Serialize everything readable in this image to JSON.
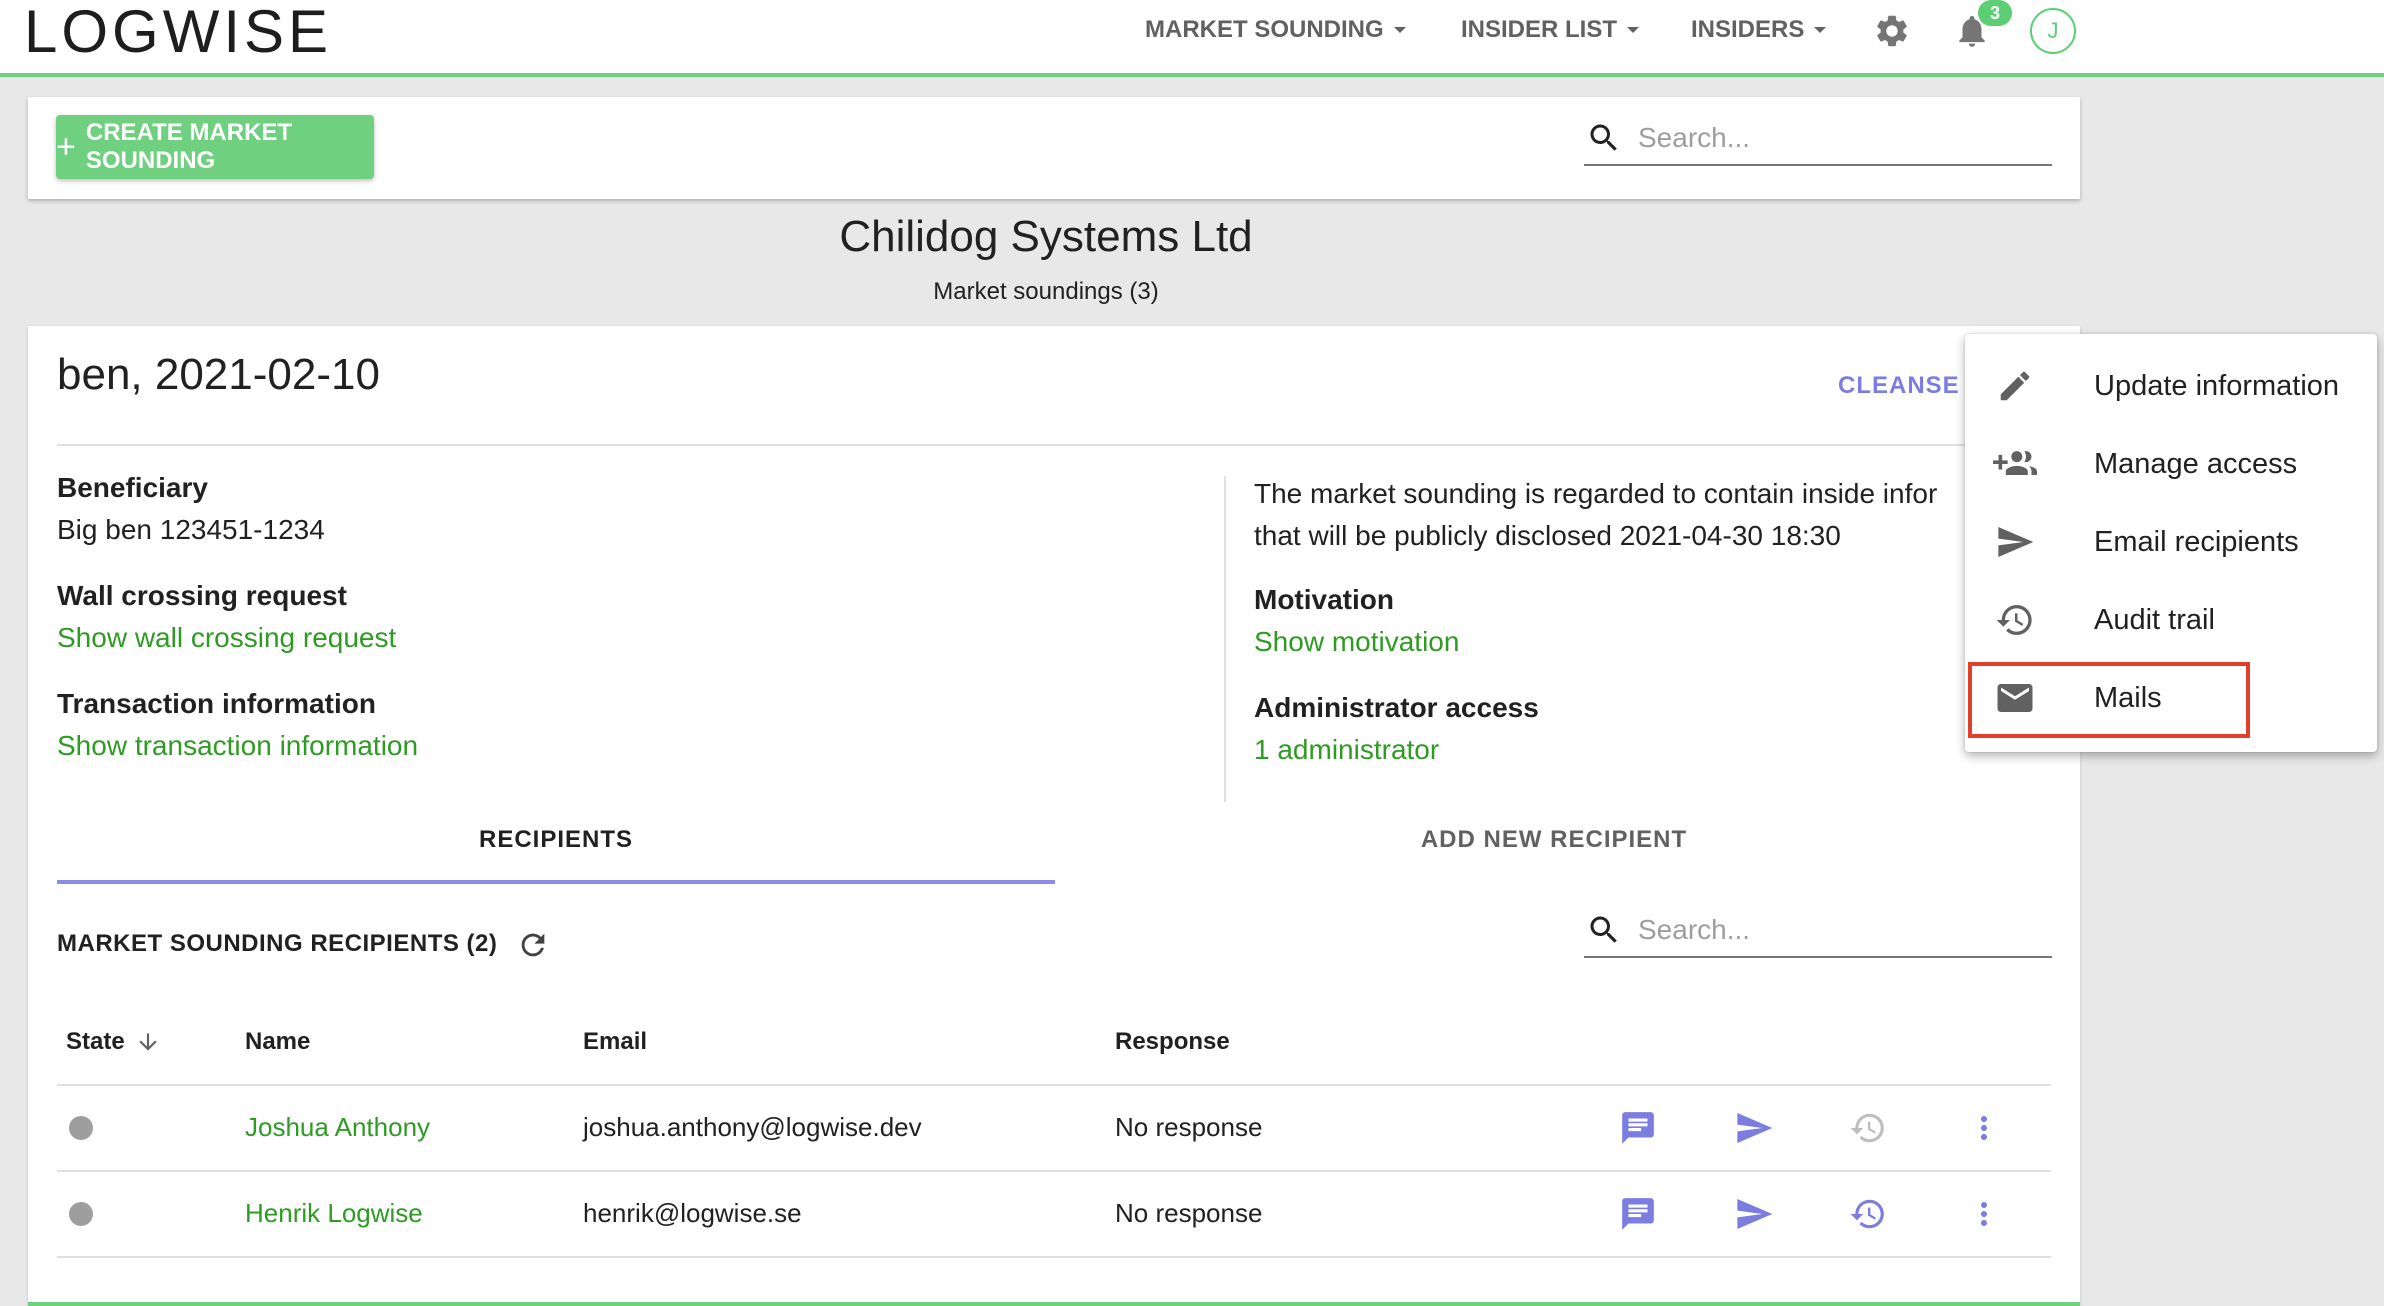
{
  "app": {
    "logo": "LOGWISE"
  },
  "nav": {
    "market_sounding": "MARKET SOUNDING",
    "insider_list": "INSIDER LIST",
    "insiders": "INSIDERS",
    "notification_count": "3",
    "avatar_initial": "J"
  },
  "toolbar": {
    "create_label": "CREATE MARKET SOUNDING",
    "search_placeholder": "Search..."
  },
  "heading": {
    "company": "Chilidog Systems Ltd",
    "subtitle": "Market soundings (3)"
  },
  "sounding": {
    "title": "ben, 2021-02-10",
    "cleanse": "CLEANSE",
    "beneficiary_label": "Beneficiary",
    "beneficiary_value": "Big ben 123451-1234",
    "wall_label": "Wall crossing request",
    "wall_link": "Show wall crossing request",
    "transaction_label": "Transaction information",
    "transaction_link": "Show transaction information",
    "inside_line1": "The market sounding is regarded to contain inside infor",
    "inside_line2": "that will be publicly disclosed 2021-04-30 18:30",
    "motivation_label": "Motivation",
    "motivation_link": "Show motivation",
    "admin_label": "Administrator access",
    "admin_link": "1 administrator"
  },
  "tabs": [
    {
      "label": "RECIPIENTS",
      "active": true
    },
    {
      "label": "ADD NEW RECIPIENT",
      "active": false
    }
  ],
  "recipients": {
    "title": "MARKET SOUNDING RECIPIENTS (2)",
    "search_placeholder": "Search...",
    "columns": {
      "state": "State",
      "name": "Name",
      "email": "Email",
      "response": "Response"
    },
    "rows": [
      {
        "name": "Joshua Anthony",
        "email": "joshua.anthony@logwise.dev",
        "response": "No response"
      },
      {
        "name": "Henrik Logwise",
        "email": "henrik@logwise.se",
        "response": "No response"
      }
    ]
  },
  "menu": {
    "items": [
      {
        "label": "Update information",
        "icon": "pencil-icon"
      },
      {
        "label": "Manage access",
        "icon": "group-add-icon"
      },
      {
        "label": "Email recipients",
        "icon": "send-icon"
      },
      {
        "label": "Audit trail",
        "icon": "history-icon"
      },
      {
        "label": "Mails",
        "icon": "mail-icon"
      }
    ]
  },
  "colors": {
    "brand_green": "#6fd17f",
    "link_green": "#2e9b22",
    "accent_purple": "#7b7de0",
    "highlight_red": "#e0402a"
  }
}
